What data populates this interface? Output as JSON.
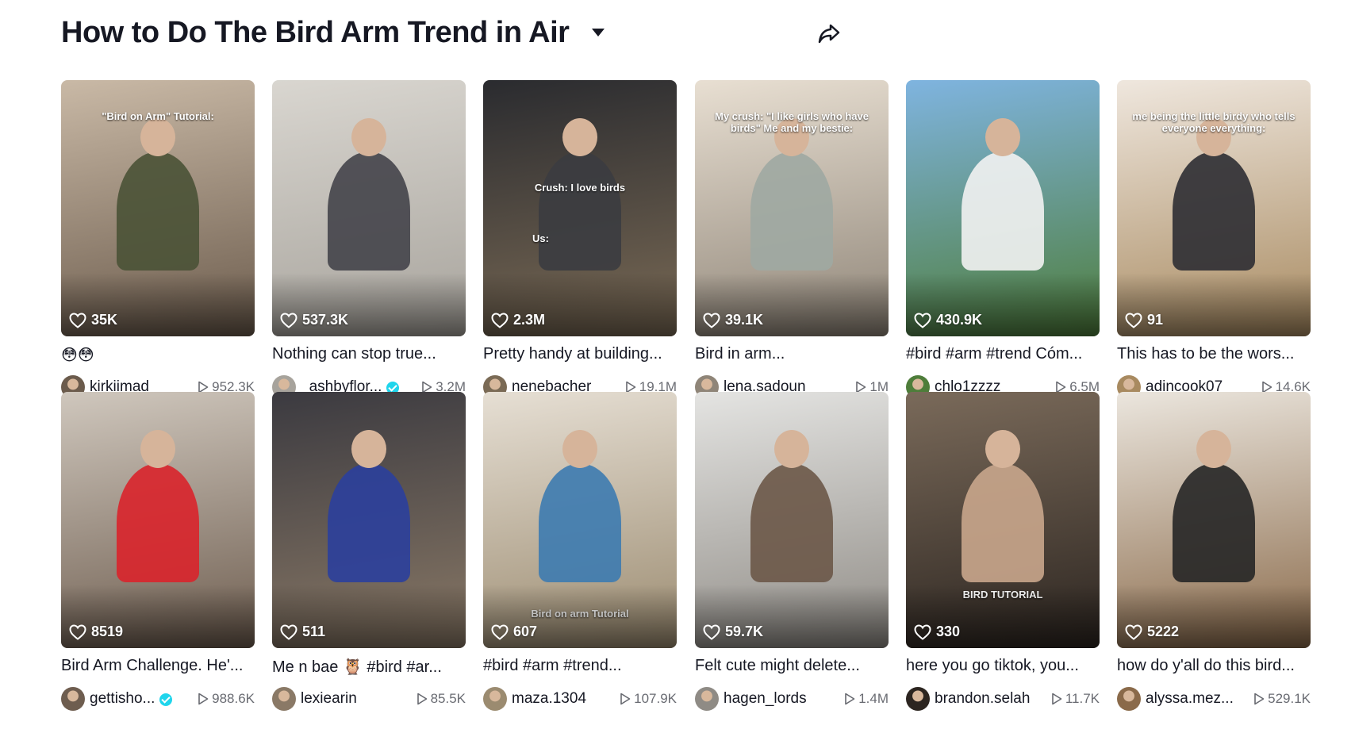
{
  "header": {
    "title": "How to Do The Bird Arm Trend in Air",
    "dropdown_icon": "caret-down-icon",
    "share_icon": "share-arrow-icon"
  },
  "videos": [
    {
      "overlay": "\"Bird on Arm\" Tutorial:",
      "likes": "35K",
      "caption": "😳😳",
      "username": "kirkiimad",
      "verified": false,
      "views": "952.3K",
      "bg": [
        "#c9b9a6",
        "#6b5b4c"
      ],
      "figure": "#4a5236"
    },
    {
      "overlay": "",
      "likes": "537.3K",
      "caption": "Nothing can stop true...",
      "username": "_ashbyflor...",
      "verified": true,
      "views": "3.2M",
      "bg": [
        "#d9d6d0",
        "#a7a39c"
      ],
      "figure": "#44444a"
    },
    {
      "overlay": "Crush: I love birds",
      "overlay2": "Us:",
      "likes": "2.3M",
      "caption": "Pretty handy at building...",
      "username": "nenebacher",
      "verified": false,
      "views": "19.1M",
      "bg": [
        "#2a2b2f",
        "#7a6a55"
      ],
      "figure": "#3b3c40"
    },
    {
      "overlay": "My crush: \"I like girls who have birds\" Me and my bestie:",
      "likes": "39.1K",
      "caption": "Bird in arm...",
      "username": "lena.sadoun",
      "verified": false,
      "views": "1M",
      "bg": [
        "#e8dfd2",
        "#8f8578"
      ],
      "figure": "#9fa8a2"
    },
    {
      "overlay": "",
      "likes": "430.9K",
      "caption": "#bird #arm #trend Cóm...",
      "username": "chlo1zzzz",
      "verified": false,
      "views": "6.5M",
      "bg": [
        "#7fb4e0",
        "#4e7d3a"
      ],
      "figure": "#f2f2f2"
    },
    {
      "overlay": "me being the little birdy who tells everyone everything:",
      "likes": "91",
      "caption": "This has to be the wors...",
      "username": "adincook07",
      "verified": false,
      "views": "14.6K",
      "bg": [
        "#efe7de",
        "#a88a60"
      ],
      "figure": "#2d2e33"
    },
    {
      "overlay": "",
      "likes": "8519",
      "caption": "Bird Arm Challenge. He'...",
      "username": "gettisho...",
      "verified": true,
      "views": "988.6K",
      "bg": [
        "#cfc7bd",
        "#6e5d4f"
      ],
      "figure": "#d9242b"
    },
    {
      "overlay": "",
      "likes": "511",
      "caption": "Me n bae 🦉 #bird #ar...",
      "username": "lexiearin",
      "verified": false,
      "views": "85.5K",
      "bg": [
        "#3b3a40",
        "#8a7966"
      ],
      "figure": "#2b3f9c"
    },
    {
      "overlay": "Bird on arm Tutorial",
      "likes": "607",
      "caption": "#bird #arm #trend...",
      "username": "maza.1304",
      "verified": false,
      "views": "107.9K",
      "bg": [
        "#e6dfd4",
        "#9b8b70"
      ],
      "figure": "#3d7bb0"
    },
    {
      "overlay": "",
      "likes": "59.7K",
      "caption": "Felt cute might delete...",
      "username": "hagen_lords",
      "verified": false,
      "views": "1.4M",
      "bg": [
        "#e4e4e2",
        "#8f8b85"
      ],
      "figure": "#6b5848"
    },
    {
      "overlay": "BIRD TUTORIAL",
      "likes": "330",
      "caption": "here you go tiktok, you...",
      "username": "brandon.selah",
      "verified": false,
      "views": "11.7K",
      "bg": [
        "#7a6a5a",
        "#2c2520"
      ],
      "figure": "#c9a68c"
    },
    {
      "overlay": "",
      "likes": "5222",
      "caption": "how do y'all do this bird...",
      "username": "alyssa.mez...",
      "verified": false,
      "views": "529.1K",
      "bg": [
        "#ebe6de",
        "#8a6a4a"
      ],
      "figure": "#262626"
    }
  ]
}
